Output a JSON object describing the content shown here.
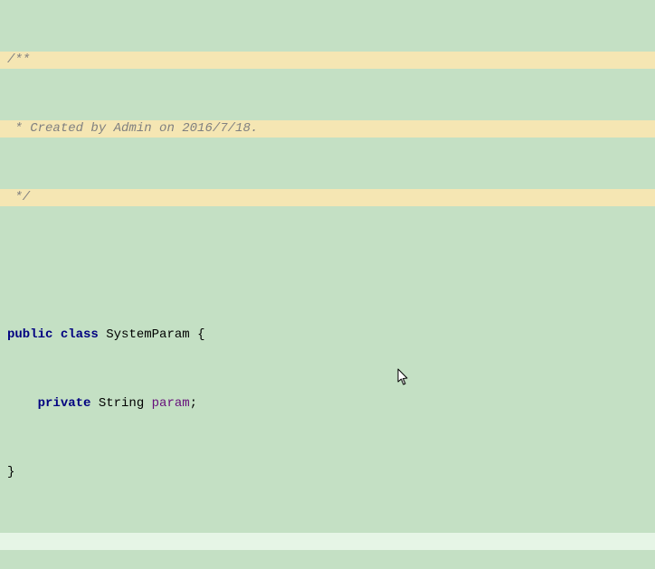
{
  "editor": {
    "lines": {
      "l1": "/**",
      "l2_prefix": " * ",
      "l2_text": "Created by Admin on 2016/7/18.",
      "l3": " */",
      "l4": "",
      "l5_kw1": "public",
      "l5_sp1": " ",
      "l5_kw2": "class",
      "l5_sp2": " ",
      "l5_name": "SystemParam",
      "l5_rest": " {",
      "l6_indent": "    ",
      "l6_kw": "private",
      "l6_sp1": " ",
      "l6_type": "String",
      "l6_sp2": " ",
      "l6_field": "param",
      "l6_semi": ";",
      "l7": "}",
      "l8": ""
    }
  }
}
